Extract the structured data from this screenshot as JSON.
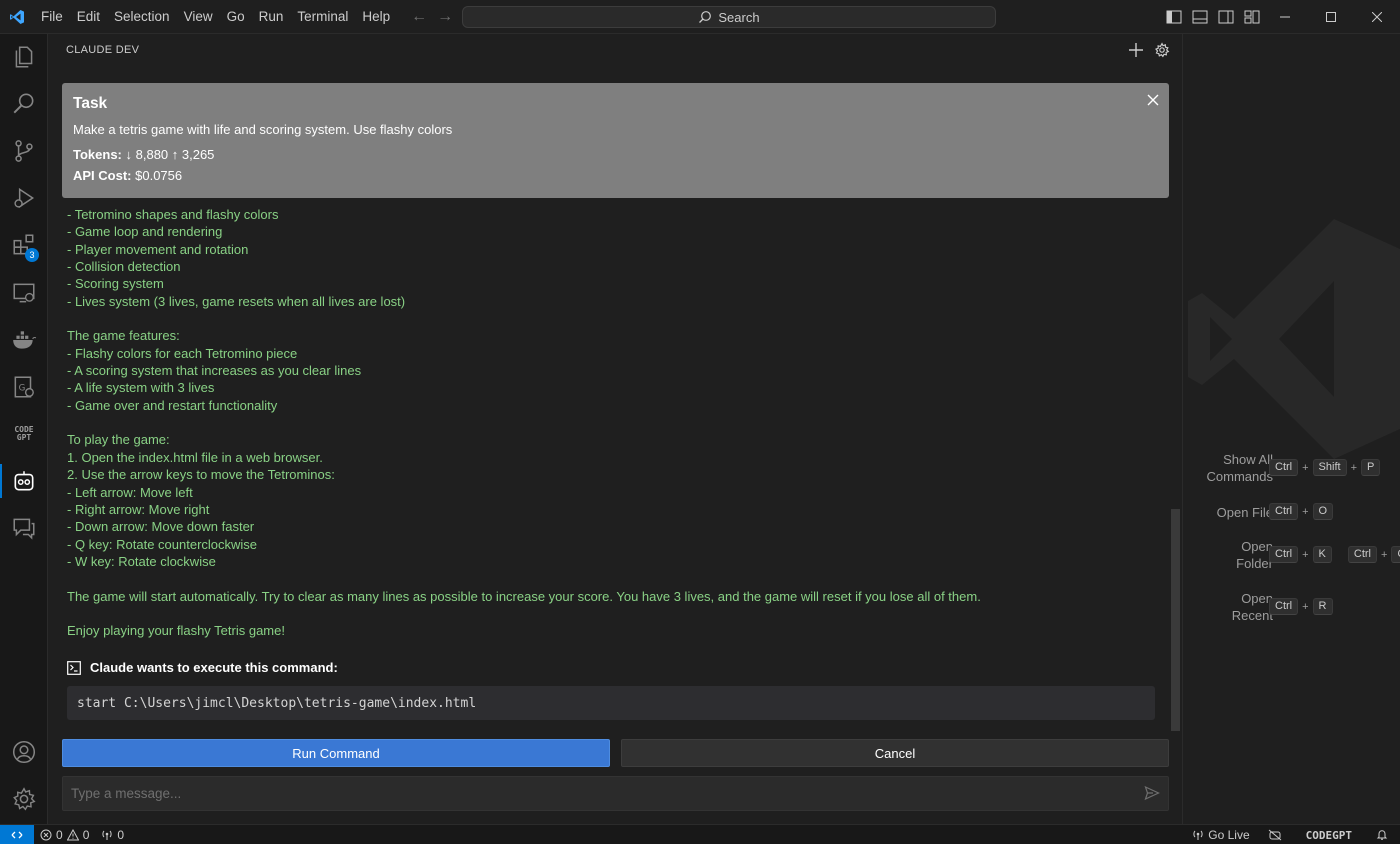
{
  "menu": [
    "File",
    "Edit",
    "Selection",
    "View",
    "Go",
    "Run",
    "Terminal",
    "Help"
  ],
  "search": {
    "label": "Search",
    "icon": "search-icon"
  },
  "panel": {
    "title": "CLAUDE DEV"
  },
  "activity": {
    "extensions_badge": "3"
  },
  "task": {
    "title": "Task",
    "description": "Make a tetris game with life and scoring system. Use flashy colors",
    "tokens_label": "Tokens:",
    "tokens_value": "↓ 8,880 ↑ 3,265",
    "cost_label": "API Cost:",
    "cost_value": "$0.0756"
  },
  "chat_lines": [
    "- Tetromino shapes and flashy colors",
    "- Game loop and rendering",
    "- Player movement and rotation",
    "- Collision detection",
    "- Scoring system",
    "- Lives system (3 lives, game resets when all lives are lost)",
    "",
    "The game features:",
    "- Flashy colors for each Tetromino piece",
    "- A scoring system that increases as you clear lines",
    "- A life system with 3 lives",
    "- Game over and restart functionality",
    "",
    "To play the game:",
    "1. Open the index.html file in a web browser.",
    "2. Use the arrow keys to move the Tetrominos:",
    "- Left arrow: Move left",
    "- Right arrow: Move right",
    "- Down arrow: Move down faster",
    "- Q key: Rotate counterclockwise",
    "- W key: Rotate clockwise",
    "",
    "The game will start automatically. Try to clear as many lines as possible to increase your score. You have 3 lives, and the game will reset if you lose all of them.",
    "",
    "Enjoy playing your flashy Tetris game!"
  ],
  "command": {
    "heading": "Claude wants to execute this command:",
    "text": "start C:\\Users\\jimcl\\Desktop\\tetris-game\\index.html",
    "run_label": "Run Command",
    "cancel_label": "Cancel"
  },
  "message": {
    "placeholder": "Type a message..."
  },
  "shortcuts": {
    "show_all_1": "Show All",
    "show_all_2": "Commands",
    "open_file": "Open File",
    "open_folder_1": "Open",
    "open_folder_2": "Folder",
    "open_recent_1": "Open",
    "open_recent_2": "Recent",
    "ctrl": "Ctrl",
    "shift": "Shift",
    "plus": "+",
    "p": "P",
    "o": "O",
    "k": "K",
    "r": "R"
  },
  "status": {
    "errors": "0",
    "warnings": "0",
    "ports": "0",
    "golive": "Go Live",
    "codegpt": "CODEGPT"
  },
  "colors": {
    "accent": "#0078d4",
    "chat_text": "#89d185",
    "run_button": "#3a78d4"
  }
}
